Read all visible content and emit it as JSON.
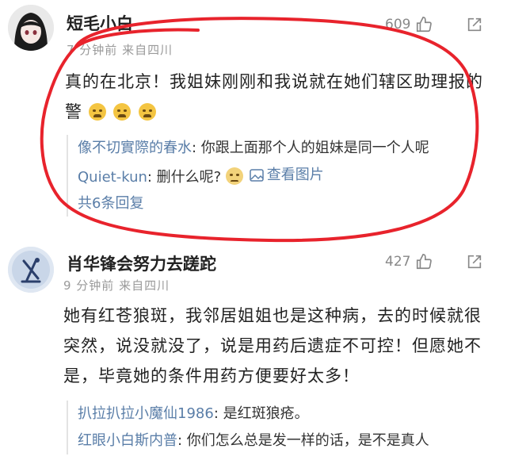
{
  "comments": [
    {
      "username": "短毛小白",
      "meta": "7 分钟前  来自四川",
      "likes": "609",
      "body_lines": [
        "真的在北京！我姐妹刚刚和我说就在她们辖区助理报的",
        "警"
      ],
      "replies": [
        {
          "user": "像不切實際的春水",
          "text": ": 你跟上面那个人的姐妹是同一个人呢"
        },
        {
          "user": "Quiet-kun",
          "text": ": 删什么呢?"
        }
      ],
      "view_image": "查看图片",
      "more_replies": "共6条回复"
    },
    {
      "username": "肖华锋会努力去蹉跎",
      "meta": "9 分钟前  来自四川",
      "likes": "427",
      "body_lines": [
        "她有红苍狼斑，我邻居姐姐也是这种病，去的时候就很",
        "突然，说没就没了，说是用药后遗症不可控！但愿她不",
        "是，毕竟她的条件用药方便要好太多！"
      ],
      "replies": [
        {
          "user": "扒拉扒拉小魔仙1986",
          "text": ": 是红斑狼疮。"
        },
        {
          "user": "红眼小白斯内普",
          "text": ": 你们怎么总是发一样的话，是不是真人"
        }
      ]
    }
  ],
  "colors": {
    "annotation_ring": "#e8232c",
    "link": "#5a7ea8",
    "meta": "#9a9a9a"
  },
  "icons": [
    "thumbs-up-icon",
    "share-icon",
    "image-icon",
    "crying-emoji-icon",
    "smirk-emoji-icon"
  ]
}
